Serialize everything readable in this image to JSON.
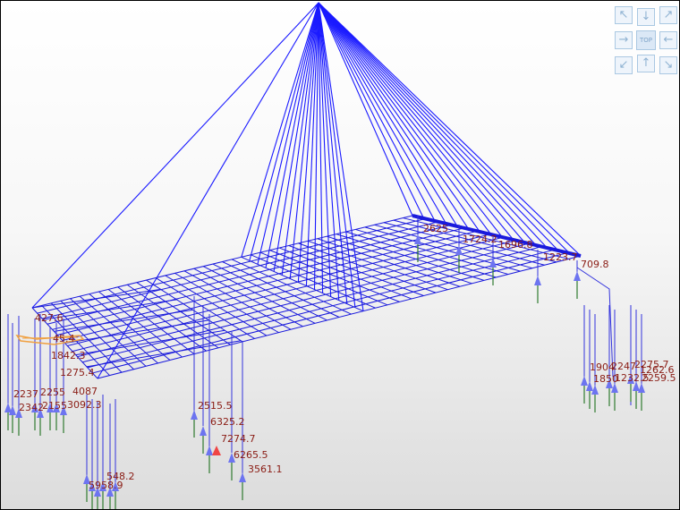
{
  "navigation": {
    "view_cube_label": "TOP",
    "icons": [
      "arrow-up-left-icon",
      "arrow-up-right-icon",
      "arrow-down-left-icon",
      "arrow-down-right-icon",
      "arrow-up-icon",
      "arrow-down-icon",
      "arrow-left-icon",
      "arrow-right-icon"
    ]
  },
  "colors": {
    "cables": "#1a1aff",
    "grid": "#1a1adc",
    "support_arrows": "#6d74f0",
    "load_lines": "#2f7a2f",
    "labels": "#8a1c14",
    "highlight_arrow": "#f04545",
    "selected_member": "#f0a040"
  },
  "left_values": {
    "v1": "427.6",
    "v2": "45.4",
    "v3": "1842.3",
    "v4": "1275.4",
    "v5": "2237",
    "v6": "2255",
    "v7": "4087",
    "v8": "2342",
    "v9": "2155",
    "v10": "3092.3",
    "v11": "548.2",
    "v12": "5958.9"
  },
  "center_values": {
    "v1": "2515.5",
    "v2": "6325.2",
    "v3": "7274.7",
    "v4": "6265.5",
    "v5": "3561.1"
  },
  "deck_values": {
    "v1": "2625",
    "v2": "1724.2",
    "v3": "1696.8",
    "v4": "1223.7",
    "v5": "709.8"
  },
  "right_values": {
    "v1": "1904",
    "v2": "2247",
    "v3": "2275.7",
    "v4": "1262.6",
    "v5": "1850",
    "v6": "1232.5",
    "v7": "2259.5"
  }
}
